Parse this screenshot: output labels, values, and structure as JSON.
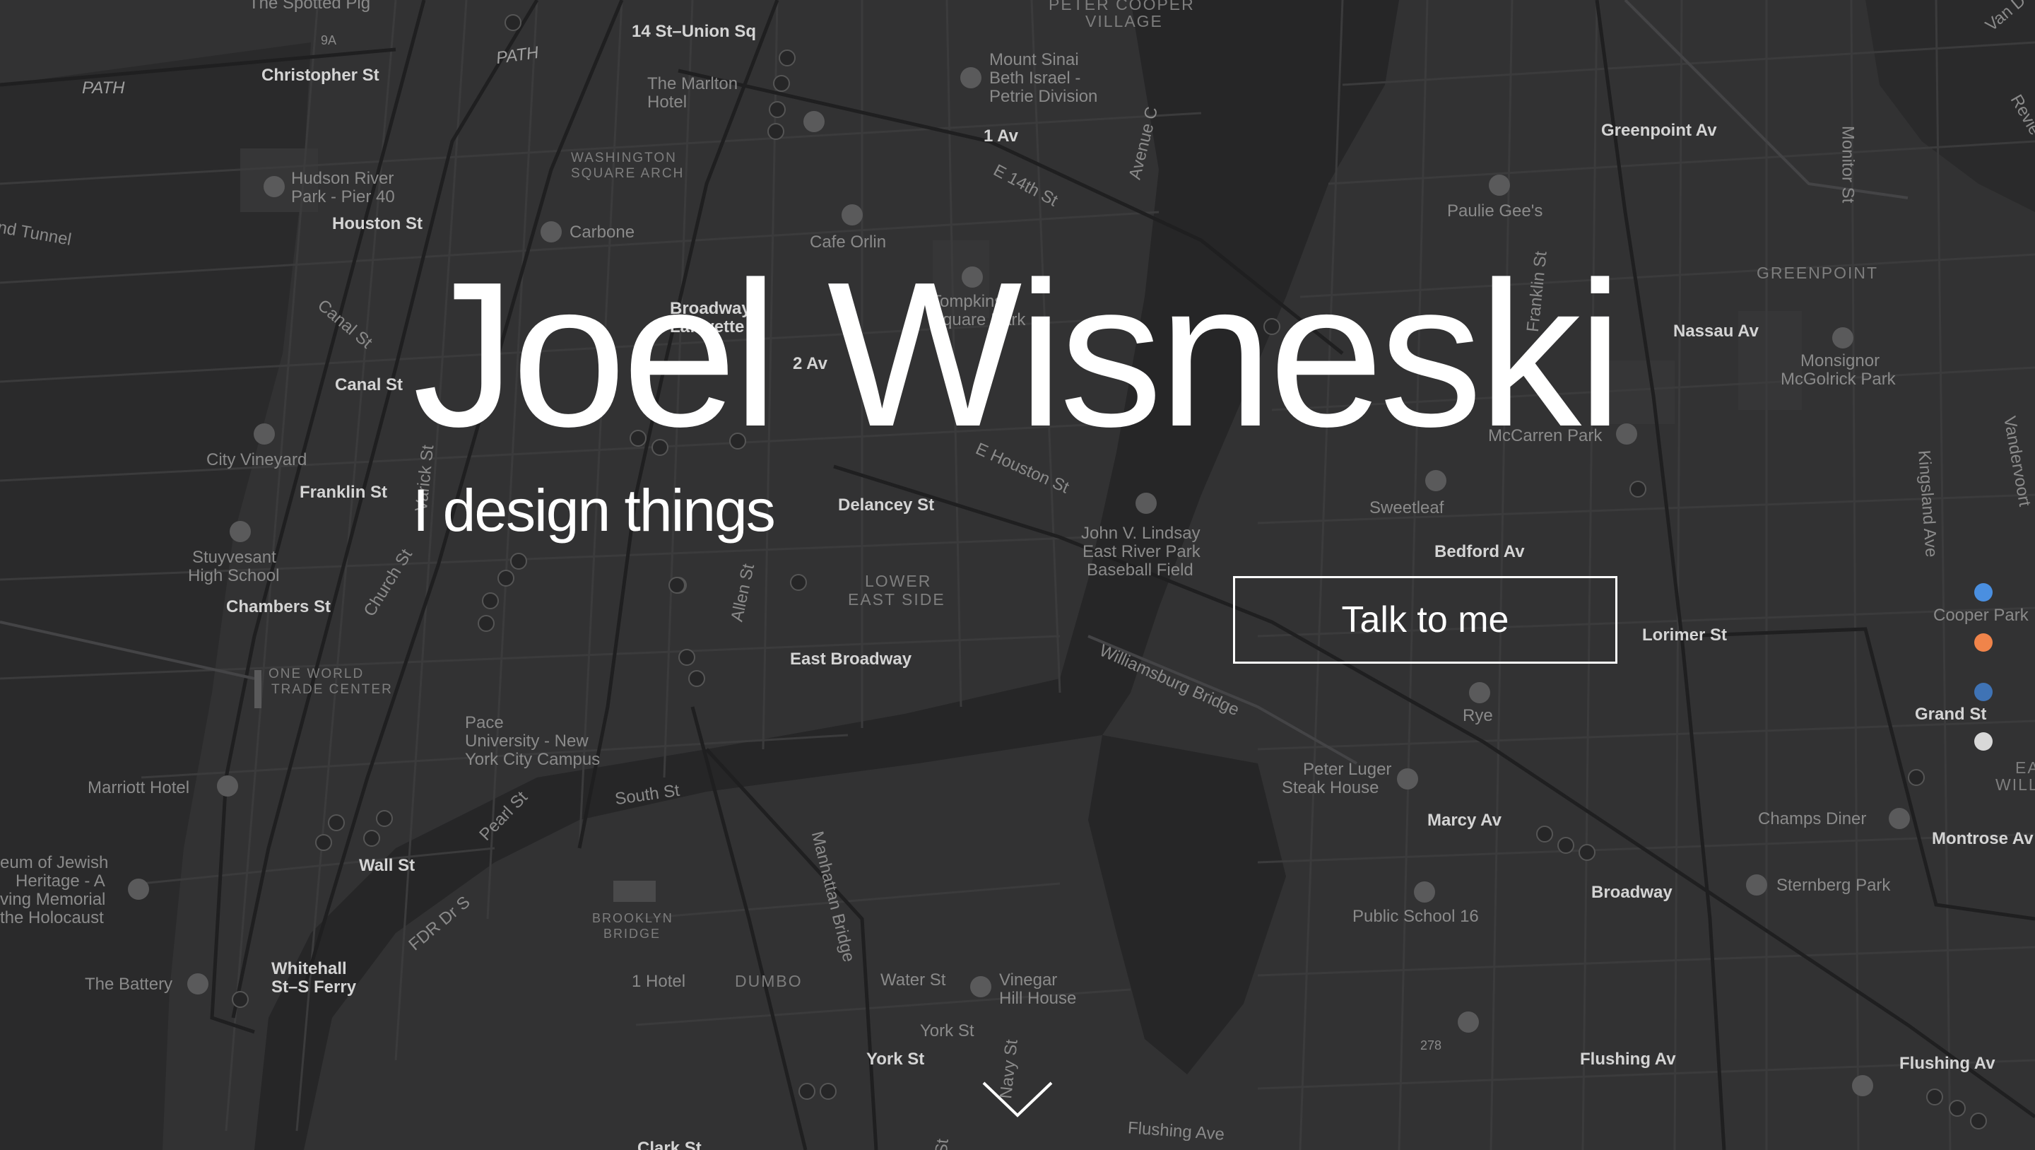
{
  "hero": {
    "title": "Joel Wisneski",
    "subtitle": "I design things",
    "cta_label": "Talk to me"
  },
  "scroll_indicator": {
    "icon": "chevron-down-icon"
  },
  "section_dots": {
    "colors": [
      "#4a8fe0",
      "#f0844a",
      "#3f73b5",
      "#d8d8d8"
    ]
  },
  "map": {
    "labels": {
      "spotted_pig": "The Spotted Pig",
      "peter_cooper": "PETER COOPER",
      "village": "VILLAGE",
      "union_sq": "14 St–Union Sq",
      "christopher": "Christopher St",
      "path1": "PATH",
      "path2": "PATH",
      "mount_sinai_1": "Mount Sinai",
      "mount_sinai_2": "Beth Israel -",
      "mount_sinai_3": "Petrie Division",
      "marlton_1": "The Marlton",
      "marlton_2": "Hotel",
      "wsa_1": "WASHINGTON",
      "wsa_2": "SQUARE ARCH",
      "av1": "1 Av",
      "e14": "E 14th St",
      "avenue_c": "Avenue C",
      "greenpoint_av": "Greenpoint Av",
      "monitor": "Monitor St",
      "hudson_1": "Hudson River",
      "hudson_2": "Park - Pier 40",
      "houston": "Houston St",
      "carbone": "Carbone",
      "cafe_orlin": "Cafe Orlin",
      "paulie": "Paulie Gee's",
      "greenpoint": "GREENPOINT",
      "franklin_st": "Franklin St",
      "tunnel": "nd Tunnel",
      "canal_st_diag": "Canal St",
      "tompkins_1": "Tompkins",
      "tompkins_2": "Square Park",
      "broadway_laf_1": "Broadway",
      "broadway_laf_2": "Lafayette",
      "nassau": "Nassau Av",
      "monsignor_1": "Monsignor",
      "monsignor_2": "McGolrick Park",
      "canal": "Canal St",
      "av2": "2 Av",
      "mccarren": "McCarren Park",
      "city_vineyard": "City Vineyard",
      "franklin": "Franklin St",
      "varick": "Varick St",
      "delancey": "Delancey St",
      "e_houston": "E Houston St",
      "sweetleaf": "Sweetleaf",
      "kingsland": "Kingsland Ave",
      "vandervoort": "Vandervoort",
      "stuy_1": "Stuyvesant",
      "stuy_2": "High School",
      "church": "Church St",
      "lindsay_1": "John V. Lindsay",
      "lindsay_2": "East River Park",
      "lindsay_3": "Baseball Field",
      "bedford": "Bedford Av",
      "chambers": "Chambers St",
      "les_1": "LOWER",
      "les_2": "EAST SIDE",
      "allen": "Allen St",
      "cooper_park": "Cooper Park",
      "lorimer": "Lorimer St",
      "wtc_1": "ONE WORLD",
      "wtc_2": "TRADE CENTER",
      "east_broadway": "East Broadway",
      "williamsburg_bridge": "Williamsburg Bridge",
      "rye": "Rye",
      "grand_st": "Grand St",
      "pace_1": "Pace",
      "pace_2": "University - New",
      "pace_3": "York City Campus",
      "peter_luger_1": "Peter Luger",
      "peter_luger_2": "Steak House",
      "east_williamsburg_1": "EA",
      "east_williamsburg_2": "WILLIAM",
      "marriott": "Marriott Hotel",
      "south_st": "South St",
      "pearl": "Pearl St",
      "marcy": "Marcy Av",
      "champs": "Champs Diner",
      "montrose": "Montrose Av",
      "jewish_1": "eum of Jewish",
      "jewish_2": "Heritage - A",
      "jewish_3": "ving Memorial",
      "jewish_4": "the Holocaust",
      "wall_st": "Wall St",
      "broadway_bk": "Broadway",
      "sternberg": "Sternberg Park",
      "fdr": "FDR Dr S",
      "brooklyn_bridge_1": "BROOKLYN",
      "brooklyn_bridge_2": "BRIDGE",
      "ps16": "Public School 16",
      "manhattan_bridge": "Manhattan Bridge",
      "battery": "The Battery",
      "whitehall_1": "Whitehall",
      "whitehall_2": "St–S Ferry",
      "one_hotel": "1 Hotel",
      "dumbo": "DUMBO",
      "water_st": "Water St",
      "vinegar_1": "Vinegar",
      "vinegar_2": "Hill House",
      "york": "York St",
      "flushing_av": "Flushing Av",
      "flushing_av2": "Flushing Av",
      "flushing_ave": "Flushing Ave",
      "york_st_street": "York St",
      "route278": "278",
      "clark": "Clark St",
      "navy": "Navy St",
      "van_dam": "Van D",
      "review": "Revie",
      "franklin_bk": "Franklin St",
      "nine_a": "9A",
      "st_label": "St"
    }
  }
}
